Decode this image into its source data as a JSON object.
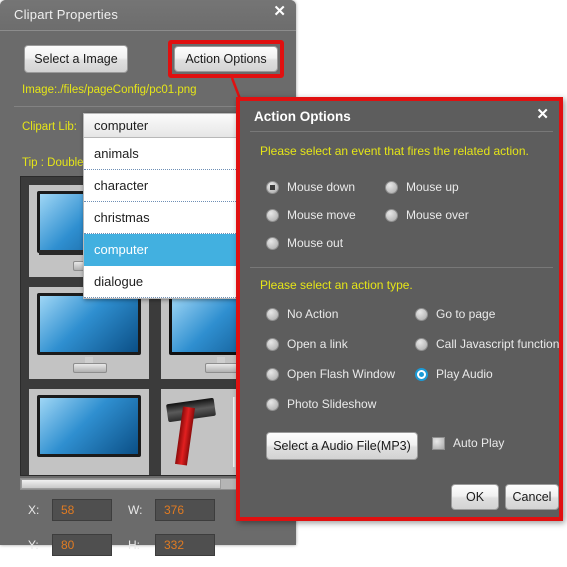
{
  "window": {
    "title": "Clipart Properties",
    "close_icon": "close-icon",
    "select_image_label": "Select a Image",
    "action_options_label": "Action Options",
    "image_path": "Image:./files/pageConfig/pc01.png",
    "clipart_lib_label": "Clipart Lib:",
    "tip_label": "Tip : Double"
  },
  "dropdown": {
    "selected": "computer",
    "options": [
      "animals",
      "character",
      "christmas",
      "computer",
      "dialogue"
    ],
    "highlight_color": "#42b0e0"
  },
  "coords": {
    "x_label": "X:",
    "x_value": "58",
    "y_label": "Y:",
    "y_value": "80",
    "w_label": "W:",
    "w_value": "376",
    "h_label": "H:",
    "h_value": "332",
    "value_color": "#e07b22"
  },
  "dialog": {
    "title": "Action Options",
    "close_icon": "close-icon",
    "accent_border": "#e01010",
    "hint_event": "Please select an event that fires the related action.",
    "hint_action": "Please select an action type.",
    "events": [
      {
        "label": "Mouse down",
        "selected": true
      },
      {
        "label": "Mouse up",
        "selected": false
      },
      {
        "label": "Mouse move",
        "selected": false
      },
      {
        "label": "Mouse over",
        "selected": false
      },
      {
        "label": "Mouse out",
        "selected": false
      }
    ],
    "actions": [
      {
        "label": "No Action",
        "selected": false
      },
      {
        "label": "Go to page",
        "selected": false
      },
      {
        "label": "Open a link",
        "selected": false
      },
      {
        "label": "Call Javascript function",
        "selected": false
      },
      {
        "label": "Open Flash Window",
        "selected": false
      },
      {
        "label": "Play Audio",
        "selected": true
      },
      {
        "label": "Photo Slideshow",
        "selected": false
      }
    ],
    "audio_button_label": "Select a Audio File(MP3)",
    "auto_play_label": "Auto Play",
    "auto_play_checked": false,
    "ok_label": "OK",
    "cancel_label": "Cancel"
  }
}
